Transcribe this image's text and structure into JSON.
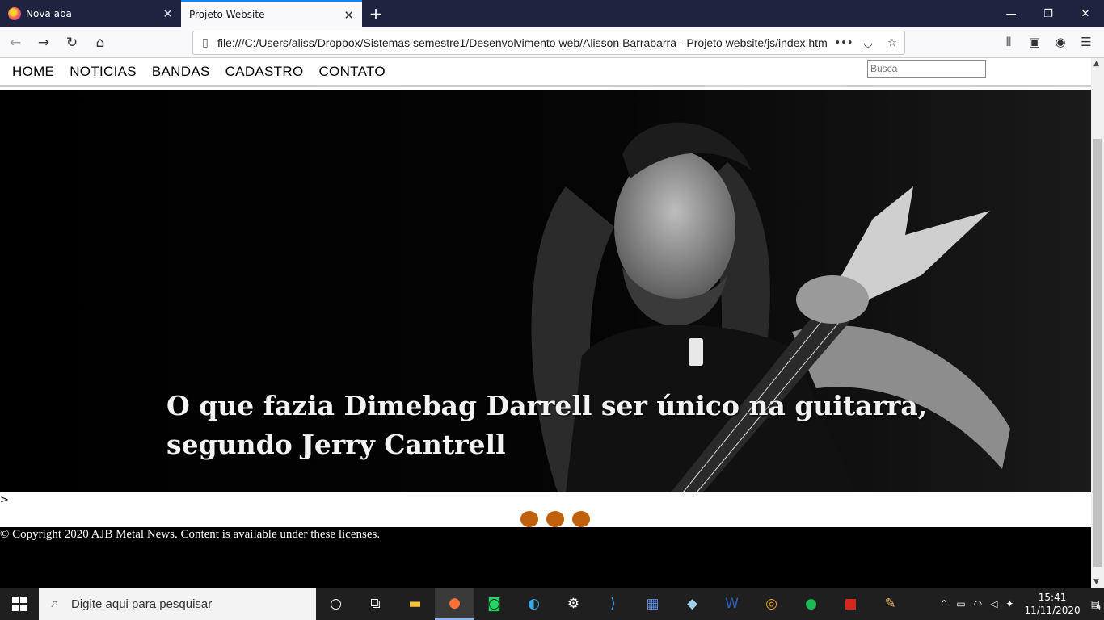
{
  "browser": {
    "tabs": [
      {
        "title": "Nova aba",
        "active": false
      },
      {
        "title": "Projeto Website",
        "active": true
      }
    ],
    "url": "file:///C:/Users/aliss/Dropbox/Sistemas semestre1/Desenvolvimento web/Alisson Barrabarra - Projeto website/js/index.htm"
  },
  "site": {
    "menu": [
      "HOME",
      "NOTICIAS",
      "BANDAS",
      "CADASTRO",
      "CONTATO"
    ],
    "search_placeholder": "Busca",
    "hero_caption": "O que fazia Dimebag Darrell ser único na guitarra, segundo Jerry Cantrell",
    "stray_text": ">",
    "slider_dots": 3,
    "footer": "© Copyright 2020 AJB Metal News. Content is available under these licenses."
  },
  "taskbar": {
    "search_placeholder": "Digite aqui para pesquisar",
    "time": "15:41",
    "date": "11/11/2020",
    "notifications": "9"
  },
  "colors": {
    "tabstrip": "#202340",
    "accent": "#0a84ff",
    "dot": "#c0600c"
  }
}
